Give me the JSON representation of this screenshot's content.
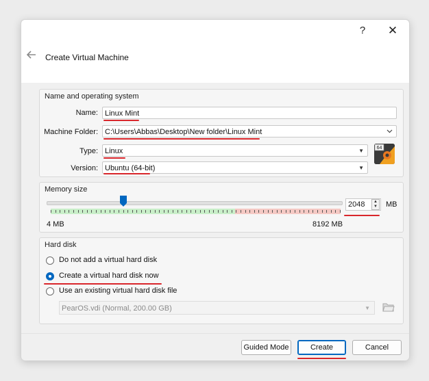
{
  "window": {
    "help_label": "?",
    "close_label": "✕",
    "title": "Create Virtual Machine"
  },
  "name_os": {
    "group_label": "Name and operating system",
    "name_label": "Name:",
    "name_value": "Linux Mint",
    "folder_label": "Machine Folder:",
    "folder_value": "C:\\Users\\Abbas\\Desktop\\New folder\\Linux Mint",
    "type_label": "Type:",
    "type_value": "Linux",
    "version_label": "Version:",
    "version_value": "Ubuntu (64-bit)",
    "os_icon_badge": "64"
  },
  "memory": {
    "group_label": "Memory size",
    "min_label": "4 MB",
    "max_label": "8192 MB",
    "value": "2048",
    "unit": "MB",
    "slider_fraction": 0.25
  },
  "hard_disk": {
    "group_label": "Hard disk",
    "option_none": "Do not add a virtual hard disk",
    "option_create": "Create a virtual hard disk now",
    "option_existing": "Use an existing virtual hard disk file",
    "selected": "create",
    "existing_file": "PearOS.vdi (Normal, 200.00 GB)"
  },
  "footer": {
    "guided_label": "Guided Mode",
    "create_label": "Create",
    "cancel_label": "Cancel"
  },
  "colors": {
    "accent": "#0067c0",
    "highlight": "#d9262b"
  }
}
